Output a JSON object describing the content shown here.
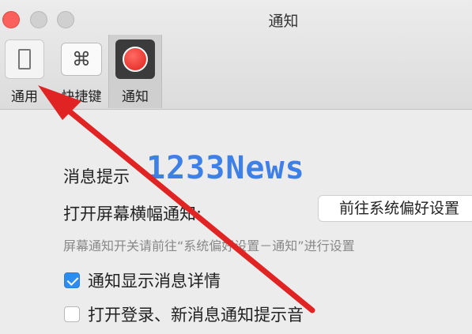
{
  "window": {
    "title": "通知"
  },
  "toolbar": {
    "items": [
      {
        "label": "通用",
        "icon": "general-phone-icon",
        "selected": false
      },
      {
        "label": "快捷键",
        "icon": "command-key-icon",
        "glyph": "⌘",
        "selected": false
      },
      {
        "label": "通知",
        "icon": "notification-record-icon",
        "selected": true
      }
    ]
  },
  "settings": {
    "message_prompt_label": "消息提示",
    "banner_label": "打开屏幕横幅通知:",
    "open_prefs_button": "前往系统偏好设置",
    "banner_hint": "屏幕通知开关请前往“系统偏好设置－通知”进行设置",
    "show_details": {
      "label": "通知显示消息详情",
      "checked": true
    },
    "login_sound": {
      "label": "打开登录、新消息通知提示音",
      "checked": false
    }
  },
  "overlay": {
    "watermark": "1233News",
    "arrow_color": "#e02424"
  },
  "colors": {
    "accent": "#2d8cf0",
    "close": "#fc605c"
  }
}
